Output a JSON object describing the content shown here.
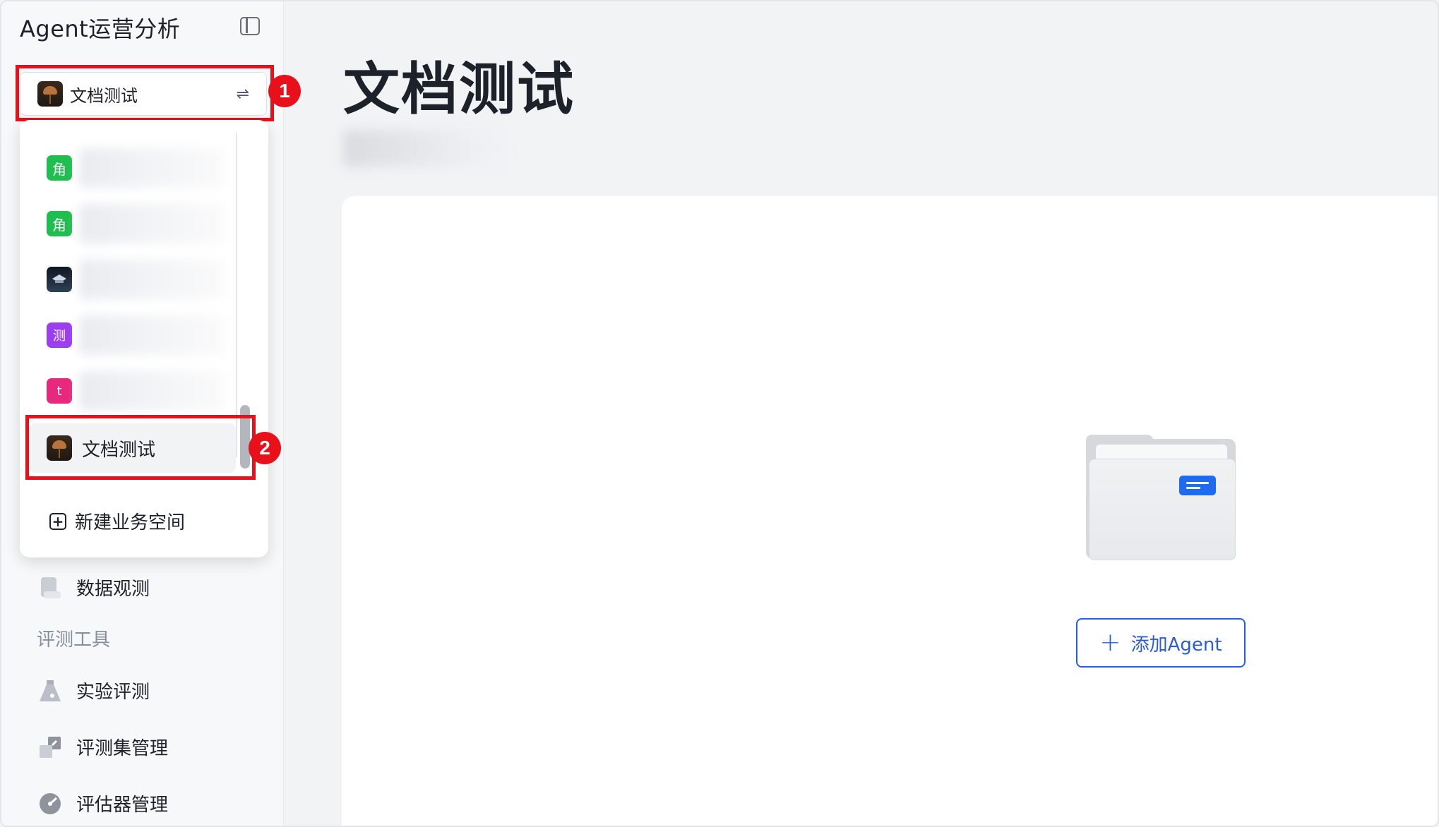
{
  "app": {
    "title": "Agent运营分析"
  },
  "workspace_selector": {
    "current": "文档测试",
    "switch_icon": "⇌"
  },
  "dropdown": {
    "items": [
      {
        "icon_text": "角",
        "icon_color": "#1fbf4f"
      },
      {
        "icon_text": "角",
        "icon_color": "#1fbf4f"
      },
      {
        "icon_text": "",
        "icon_color": "#1b2838"
      },
      {
        "icon_text": "测",
        "icon_color": "#9b3ef0"
      },
      {
        "icon_text": "t",
        "icon_color": "#e8287c"
      }
    ],
    "selected": "文档测试",
    "new_workspace_label": "新建业务空间"
  },
  "annotations": {
    "marker_1": "1",
    "marker_2": "2"
  },
  "nav": {
    "data_observe": "数据观测",
    "section_eval_tools": "评测工具",
    "experiment_eval": "实验评测",
    "eval_set_manage": "评测集管理",
    "evaluator_manage": "评估器管理"
  },
  "main": {
    "title": "文档测试",
    "add_agent_label": "添加Agent",
    "add_agent_icon": "+"
  },
  "colors": {
    "accent": "#2b5cdb",
    "highlight": "#e8101a"
  }
}
